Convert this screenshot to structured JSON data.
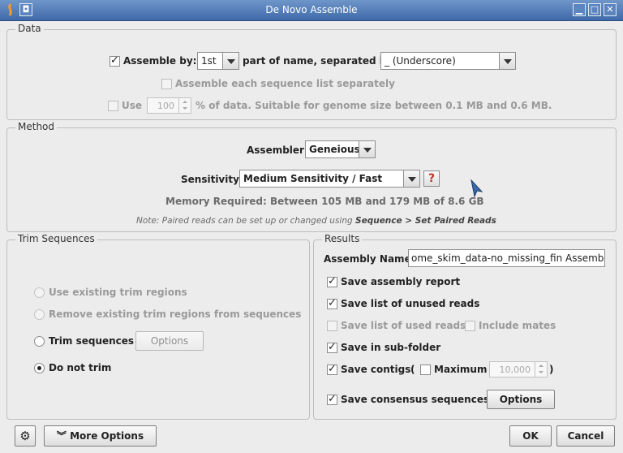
{
  "window": {
    "title": "De Novo Assemble"
  },
  "data_section": {
    "legend": "Data",
    "assemble_by_label": "Assemble by:",
    "assemble_by_value": "1st",
    "part_of_name_label": "part of name, separated by",
    "separator_value": "_ (Underscore)",
    "each_list_label": "Assemble each sequence list separately",
    "use_label": "Use",
    "use_value": "100",
    "use_suffix": "% of data. Suitable for genome size between 0.1 MB and 0.6 MB."
  },
  "method_section": {
    "legend": "Method",
    "assembler_label": "Assembler:",
    "assembler_value": "Geneious",
    "sensitivity_label": "Sensitivity:",
    "sensitivity_value": "Medium Sensitivity / Fast",
    "help_glyph": "?",
    "memory_text": "Memory Required: Between 105 MB and 179 MB of 8.6 GB",
    "note_prefix": "Note: Paired reads can be set up or changed using",
    "note_link": "Sequence > Set Paired Reads"
  },
  "trim_section": {
    "legend": "Trim Sequences",
    "opt_existing": "Use existing trim regions",
    "opt_remove": "Remove existing trim regions from sequences",
    "opt_trim": "Trim sequences",
    "options_btn": "Options",
    "opt_no_trim": "Do not trim"
  },
  "results_section": {
    "legend": "Results",
    "assembly_name_label": "Assembly Name",
    "assembly_name_value": "ome_skim_data-no_missing_fin Assembly",
    "save_report": "Save assembly report",
    "save_unused": "Save list of unused reads",
    "save_used": "Save list of used reads",
    "include_mates": "Include mates",
    "save_subfolder": "Save in sub-folder",
    "save_contigs": "Save contigs",
    "paren_open": "(",
    "maximum_label": "Maximum",
    "maximum_value": "10,000",
    "paren_close": ")",
    "save_consensus": "Save consensus sequences",
    "options_btn": "Options"
  },
  "footer": {
    "more_options": "More Options",
    "ok": "OK",
    "cancel": "Cancel"
  }
}
